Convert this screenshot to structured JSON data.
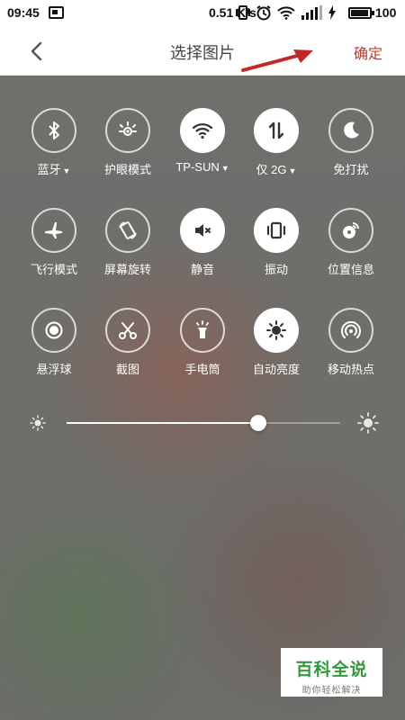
{
  "status_bar": {
    "time": "09:45",
    "network_speed": "0.51 K/s",
    "battery": "100"
  },
  "header": {
    "title": "选择图片",
    "confirm_label": "确定"
  },
  "quick_settings": {
    "rows": [
      [
        {
          "label": "蓝牙",
          "icon": "bluetooth-icon",
          "active": false,
          "dropdown": true
        },
        {
          "label": "护眼模式",
          "icon": "eye-care-icon",
          "active": false,
          "dropdown": false
        },
        {
          "label": "TP-SUN",
          "icon": "wifi-icon",
          "active": true,
          "dropdown": true
        },
        {
          "label": "仅 2G",
          "icon": "mobile-data-icon",
          "active": true,
          "dropdown": true
        },
        {
          "label": "免打扰",
          "icon": "moon-icon",
          "active": false,
          "dropdown": false
        }
      ],
      [
        {
          "label": "飞行模式",
          "icon": "airplane-icon",
          "active": false,
          "dropdown": false
        },
        {
          "label": "屏幕旋转",
          "icon": "rotate-icon",
          "active": false,
          "dropdown": false
        },
        {
          "label": "静音",
          "icon": "mute-icon",
          "active": true,
          "dropdown": false
        },
        {
          "label": "振动",
          "icon": "vibrate-icon",
          "active": true,
          "dropdown": false
        },
        {
          "label": "位置信息",
          "icon": "location-icon",
          "active": false,
          "dropdown": false
        }
      ],
      [
        {
          "label": "悬浮球",
          "icon": "floating-ball-icon",
          "active": false,
          "dropdown": false
        },
        {
          "label": "截图",
          "icon": "scissors-icon",
          "active": false,
          "dropdown": false
        },
        {
          "label": "手电筒",
          "icon": "flashlight-icon",
          "active": false,
          "dropdown": false
        },
        {
          "label": "自动亮度",
          "icon": "auto-brightness-icon",
          "active": true,
          "dropdown": false
        },
        {
          "label": "移动热点",
          "icon": "hotspot-icon",
          "active": false,
          "dropdown": false
        }
      ]
    ]
  },
  "brightness": {
    "level": 0.7
  },
  "watermark": {
    "title": "百科全说",
    "subtitle": "助你轻松解决"
  },
  "colors": {
    "accent": "#c0382c",
    "watermark_green": "#2e9b3a",
    "overlay": "#6e6e6c"
  }
}
